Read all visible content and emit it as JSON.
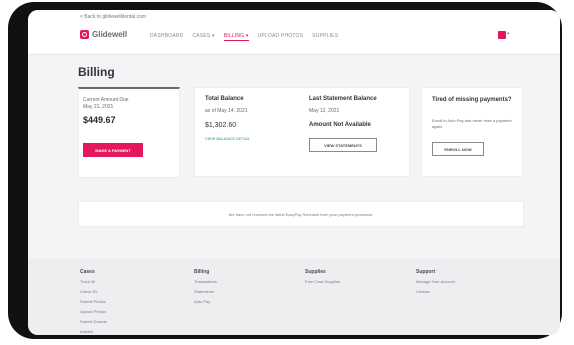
{
  "topbar": {
    "back_link": "< Back to glidewelldental.com",
    "brand": "Glidewell",
    "nav": [
      {
        "label": "DASHBOARD"
      },
      {
        "label": "CASES ▾"
      },
      {
        "label": "BILLING ▾"
      },
      {
        "label": "UPLOAD PHOTOS"
      },
      {
        "label": "SUPPLIES"
      }
    ],
    "active_nav_index": 2,
    "cart_caret": "▾"
  },
  "page": {
    "title": "Billing"
  },
  "current_amount": {
    "label": "Current Amount Due",
    "date": "May 21, 2021",
    "amount": "$449.67",
    "pay_button": "MAKE A PAYMENT"
  },
  "balance": {
    "total_label": "Total Balance",
    "total_sub": "as of May 14, 2021",
    "total_amount": "$1,302.60",
    "total_link": "VIEW BALANCE DETAIL",
    "statement_label": "Last Statement Balance",
    "statement_date": "May 12, 2021",
    "statement_status": "Amount Not Available",
    "statement_button": "VIEW STATEMENTS"
  },
  "autopay": {
    "title": "Tired of missing payments?",
    "text": "Enroll in Auto Pay and never miss a payment again.",
    "button": "ENROLL NOW"
  },
  "notice": "We have not received the latest EasyPay Schedule from your payment processor.",
  "footer": {
    "columns": [
      {
        "title": "Cases",
        "links": [
          "Track All",
          "Check Rx",
          "Submit Photos",
          "Upload Photos",
          "Submit Dowels",
          "Articles"
        ]
      },
      {
        "title": "Billing",
        "links": [
          "Transactions",
          "Statements",
          "Auto Pay"
        ]
      },
      {
        "title": "Supplies",
        "links": [
          "Free Case Supplies"
        ]
      },
      {
        "title": "Support",
        "links": [
          "Manage Your Account",
          "Contact"
        ]
      }
    ]
  },
  "colors": {
    "accent": "#e3175c",
    "success": "#2e9a5a",
    "frame": "#111111"
  }
}
